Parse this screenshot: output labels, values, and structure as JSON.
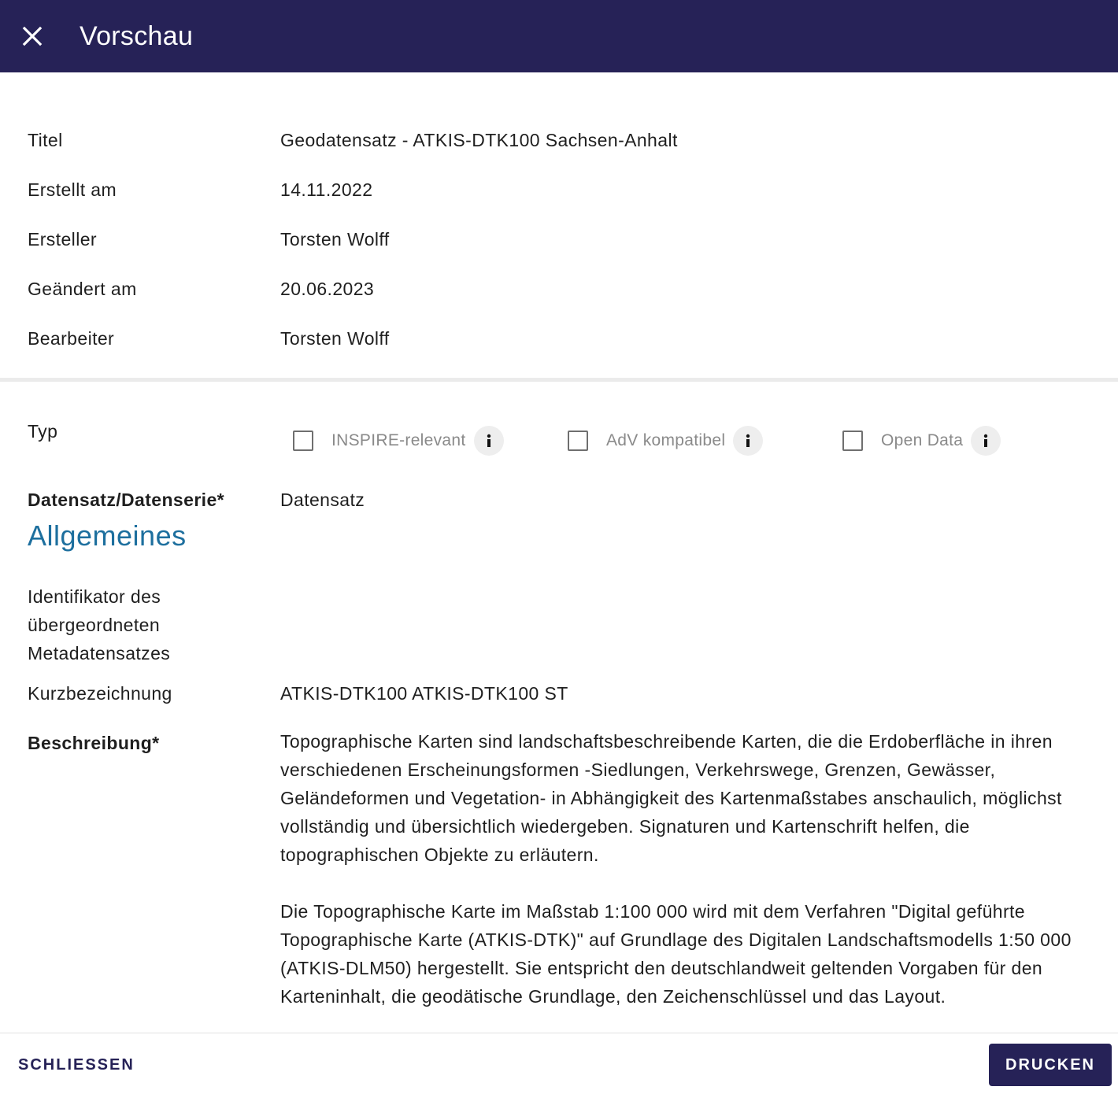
{
  "header": {
    "title": "Vorschau"
  },
  "meta": [
    {
      "label": "Titel",
      "value": "Geodatensatz - ATKIS-DTK100 Sachsen-Anhalt"
    },
    {
      "label": "Erstellt am",
      "value": "14.11.2022"
    },
    {
      "label": "Ersteller",
      "value": "Torsten Wolff"
    },
    {
      "label": "Geändert am",
      "value": "20.06.2023"
    },
    {
      "label": "Bearbeiter",
      "value": "Torsten Wolff"
    }
  ],
  "typ": {
    "label": "Typ",
    "options": [
      {
        "label": "INSPIRE-relevant",
        "checked": false
      },
      {
        "label": "AdV kompatibel",
        "checked": false
      },
      {
        "label": "Open Data",
        "checked": false
      }
    ]
  },
  "datensatz": {
    "label": "Datensatz/Datenserie*",
    "value": "Datensatz"
  },
  "section": {
    "title": "Allgemeines"
  },
  "identifikator": {
    "label": "Identifikator des übergeordneten Metadatensatzes"
  },
  "kurzbezeichnung": {
    "label": "Kurzbezeichnung",
    "value": "ATKIS-DTK100 ATKIS-DTK100 ST"
  },
  "beschreibung": {
    "label": "Beschreibung*",
    "paragraphs": [
      "Topographische Karten sind landschaftsbeschreibende Karten, die die Erdoberfläche in ihren verschiedenen Erscheinungsformen -Siedlungen, Verkehrswege, Grenzen, Gewässer, Geländeformen und Vegetation- in Abhängigkeit des Kartenmaßstabes anschaulich, möglichst vollständig und übersichtlich wiedergeben. Signaturen und Kartenschrift helfen, die topographischen Objekte zu erläutern.",
      "Die Topographische Karte im Maßstab 1:100 000 wird mit dem Verfahren \"Digital geführte Topographische Karte (ATKIS-DTK)\" auf Grundlage des Digitalen Landschaftsmodells 1:50 000 (ATKIS-DLM50) hergestellt. Sie entspricht den deutschlandweit geltenden Vorgaben für den Karteninhalt, die geodätische Grundlage, den Zeichenschlüssel und das Layout."
    ]
  },
  "footer": {
    "close_label": "SCHLIESSEN",
    "print_label": "DRUCKEN"
  },
  "colors": {
    "primary": "#262257",
    "section": "#1d6f9e"
  }
}
